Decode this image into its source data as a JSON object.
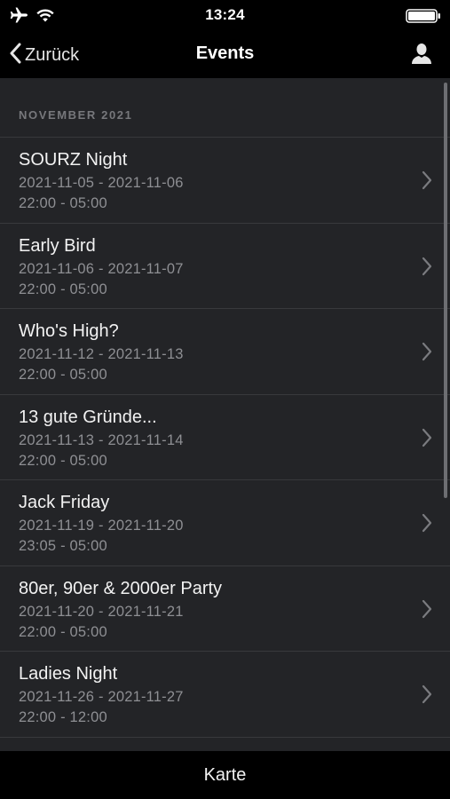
{
  "status_bar": {
    "time": "13:24",
    "icons": [
      "airplane-icon",
      "wifi-icon",
      "battery-icon"
    ]
  },
  "nav": {
    "back_label": "Zurück",
    "title": "Events",
    "right_icon": "person-icon"
  },
  "section": {
    "header": "NOVEMBER 2021"
  },
  "events": [
    {
      "title": "SOURZ Night",
      "dates": "2021-11-05 - 2021-11-06",
      "times": "22:00 - 05:00"
    },
    {
      "title": "Early Bird",
      "dates": "2021-11-06 - 2021-11-07",
      "times": "22:00 - 05:00"
    },
    {
      "title": "Who's High?",
      "dates": "2021-11-12 - 2021-11-13",
      "times": "22:00 - 05:00"
    },
    {
      "title": "13 gute Gründe...",
      "dates": "2021-11-13 - 2021-11-14",
      "times": "22:00 - 05:00"
    },
    {
      "title": "Jack Friday",
      "dates": "2021-11-19 - 2021-11-20",
      "times": "23:05 - 05:00"
    },
    {
      "title": "80er, 90er & 2000er Party",
      "dates": "2021-11-20 - 2021-11-21",
      "times": "22:00 - 05:00"
    },
    {
      "title": "Ladies Night",
      "dates": "2021-11-26 - 2021-11-27",
      "times": "22:00 - 12:00"
    }
  ],
  "bottom_bar": {
    "map_label": "Karte"
  },
  "colors": {
    "background": "#000000",
    "list_background": "#232427",
    "separator": "#38393c",
    "primary_text": "#f2f2f2",
    "secondary_text": "#8e8f93",
    "section_header": "#77787c"
  }
}
